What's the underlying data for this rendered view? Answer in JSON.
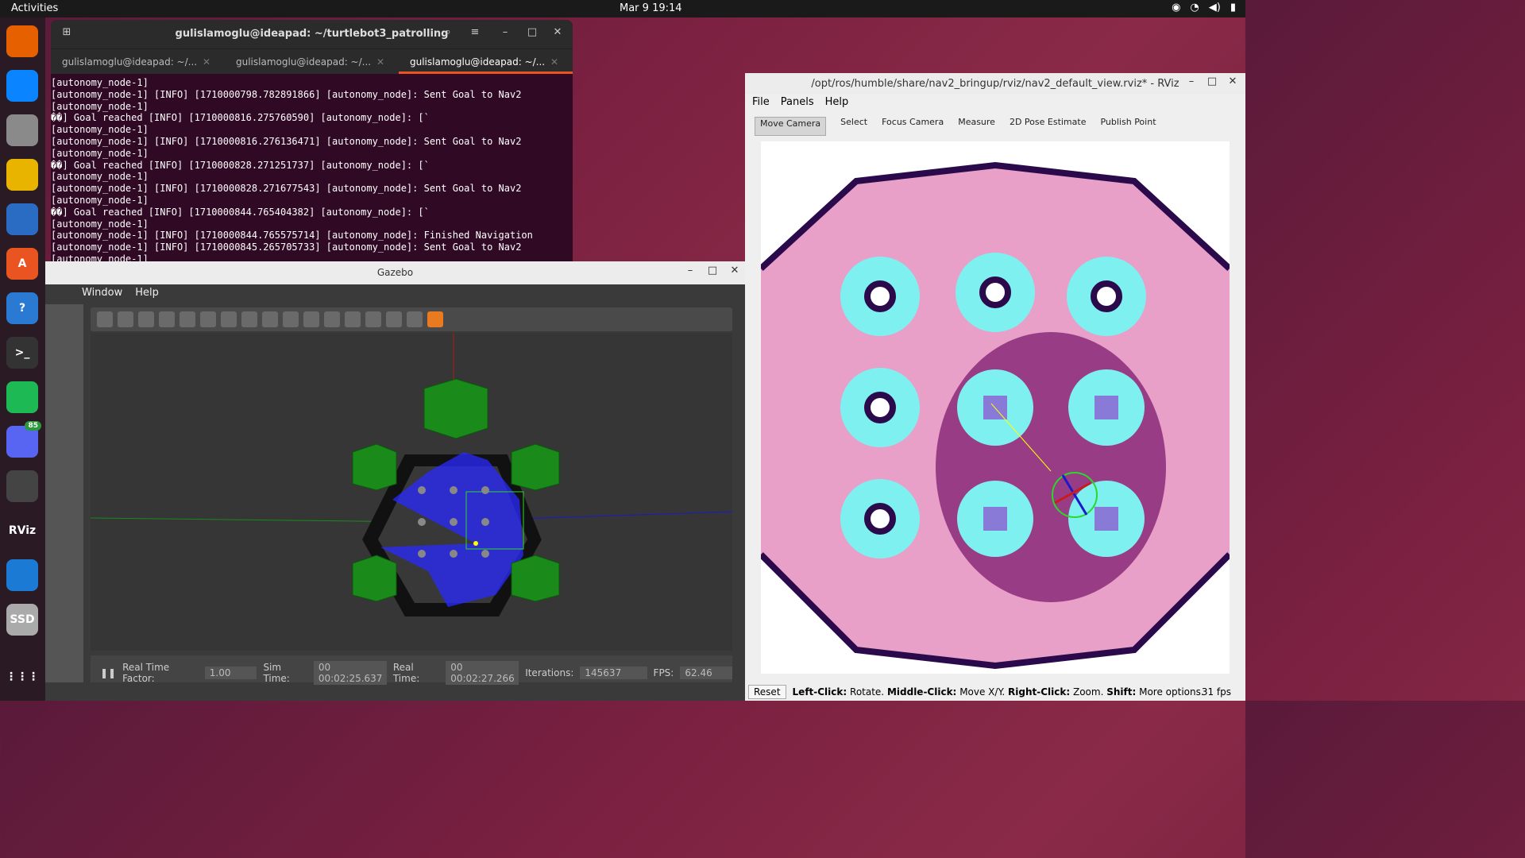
{
  "topbar": {
    "activities": "Activities",
    "clock": "Mar 9  19:14"
  },
  "dock": [
    {
      "name": "firefox-icon",
      "glyph": "",
      "bg": "#e66000"
    },
    {
      "name": "thunderbird-icon",
      "glyph": "",
      "bg": "#0a84ff"
    },
    {
      "name": "files-icon",
      "glyph": "",
      "bg": "#8a8a8a"
    },
    {
      "name": "rhythmbox-icon",
      "glyph": "",
      "bg": "#e8b400"
    },
    {
      "name": "writer-icon",
      "glyph": "",
      "bg": "#2a6cc4"
    },
    {
      "name": "app-center-icon",
      "glyph": "A",
      "bg": "#e95420"
    },
    {
      "name": "help-icon",
      "glyph": "?",
      "bg": "#2a7ad4"
    },
    {
      "name": "terminal-icon",
      "glyph": ">_",
      "bg": "#333"
    },
    {
      "name": "spotify-icon",
      "glyph": "",
      "bg": "#1db954"
    },
    {
      "name": "discord-icon",
      "glyph": "",
      "bg": "#5865f2",
      "badge": "85"
    },
    {
      "name": "sublime-icon",
      "glyph": "",
      "bg": "#444"
    },
    {
      "name": "rviz-icon",
      "glyph": "RViz",
      "bg": "#2a1a24"
    },
    {
      "name": "vscode-icon",
      "glyph": "",
      "bg": "#1a7ad4"
    },
    {
      "name": "ssd-icon",
      "glyph": "SSD",
      "bg": "#aaa"
    },
    {
      "name": "apps-grid-icon",
      "glyph": "⋮⋮⋮",
      "bg": "#2a1a24"
    }
  ],
  "terminal": {
    "title": "gulislamoglu@ideapad: ~/turtlebot3_patrolling",
    "tabs": [
      "gulislamoglu@ideapad: ~/...",
      "gulislamoglu@ideapad: ~/...",
      "gulislamoglu@ideapad: ~/..."
    ],
    "lines": [
      "[autonomy_node-1]",
      "[autonomy_node-1] [INFO] [1710000798.782891866] [autonomy_node]: Sent Goal to Nav2",
      "[autonomy_node-1]",
      "��] Goal reached [INFO] [1710000816.275760590] [autonomy_node]: [`",
      "[autonomy_node-1]",
      "[autonomy_node-1] [INFO] [1710000816.276136471] [autonomy_node]: Sent Goal to Nav2",
      "[autonomy_node-1]",
      "��] Goal reached [INFO] [1710000828.271251737] [autonomy_node]: [`",
      "[autonomy_node-1]",
      "[autonomy_node-1] [INFO] [1710000828.271677543] [autonomy_node]: Sent Goal to Nav2",
      "[autonomy_node-1]",
      "��] Goal reached [INFO] [1710000844.765404382] [autonomy_node]: [`",
      "[autonomy_node-1]",
      "[autonomy_node-1] [INFO] [1710000844.765575714] [autonomy_node]: Finished Navigation",
      "[autonomy_node-1] [INFO] [1710000845.265705733] [autonomy_node]: Sent Goal to Nav2",
      "[autonomy_node-1]"
    ]
  },
  "gazebo": {
    "title": "Gazebo",
    "menu": [
      "Window",
      "Help"
    ],
    "status": {
      "rtf_label": "Real Time Factor:",
      "rtf": "1.00",
      "sim_label": "Sim Time:",
      "sim": "00 00:02:25.637",
      "real_label": "Real Time:",
      "real": "00 00:02:27.266",
      "iter_label": "Iterations:",
      "iter": "145637",
      "fps_label": "FPS:",
      "fps": "62.46"
    }
  },
  "rviz": {
    "title": "/opt/ros/humble/share/nav2_bringup/rviz/nav2_default_view.rviz* - RViz",
    "menu": [
      "File",
      "Panels",
      "Help"
    ],
    "tools": [
      "Move Camera",
      "Select",
      "Focus Camera",
      "Measure",
      "2D Pose Estimate",
      "Publish Point"
    ],
    "reset": "Reset",
    "hint": {
      "b1": "Left-Click:",
      "t1": "Rotate.",
      "b2": "Middle-Click:",
      "t2": "Move X/Y.",
      "b3": "Right-Click:",
      "t3": "Zoom.",
      "b4": "Shift:",
      "t4": "More options."
    },
    "fps": "31 fps"
  }
}
